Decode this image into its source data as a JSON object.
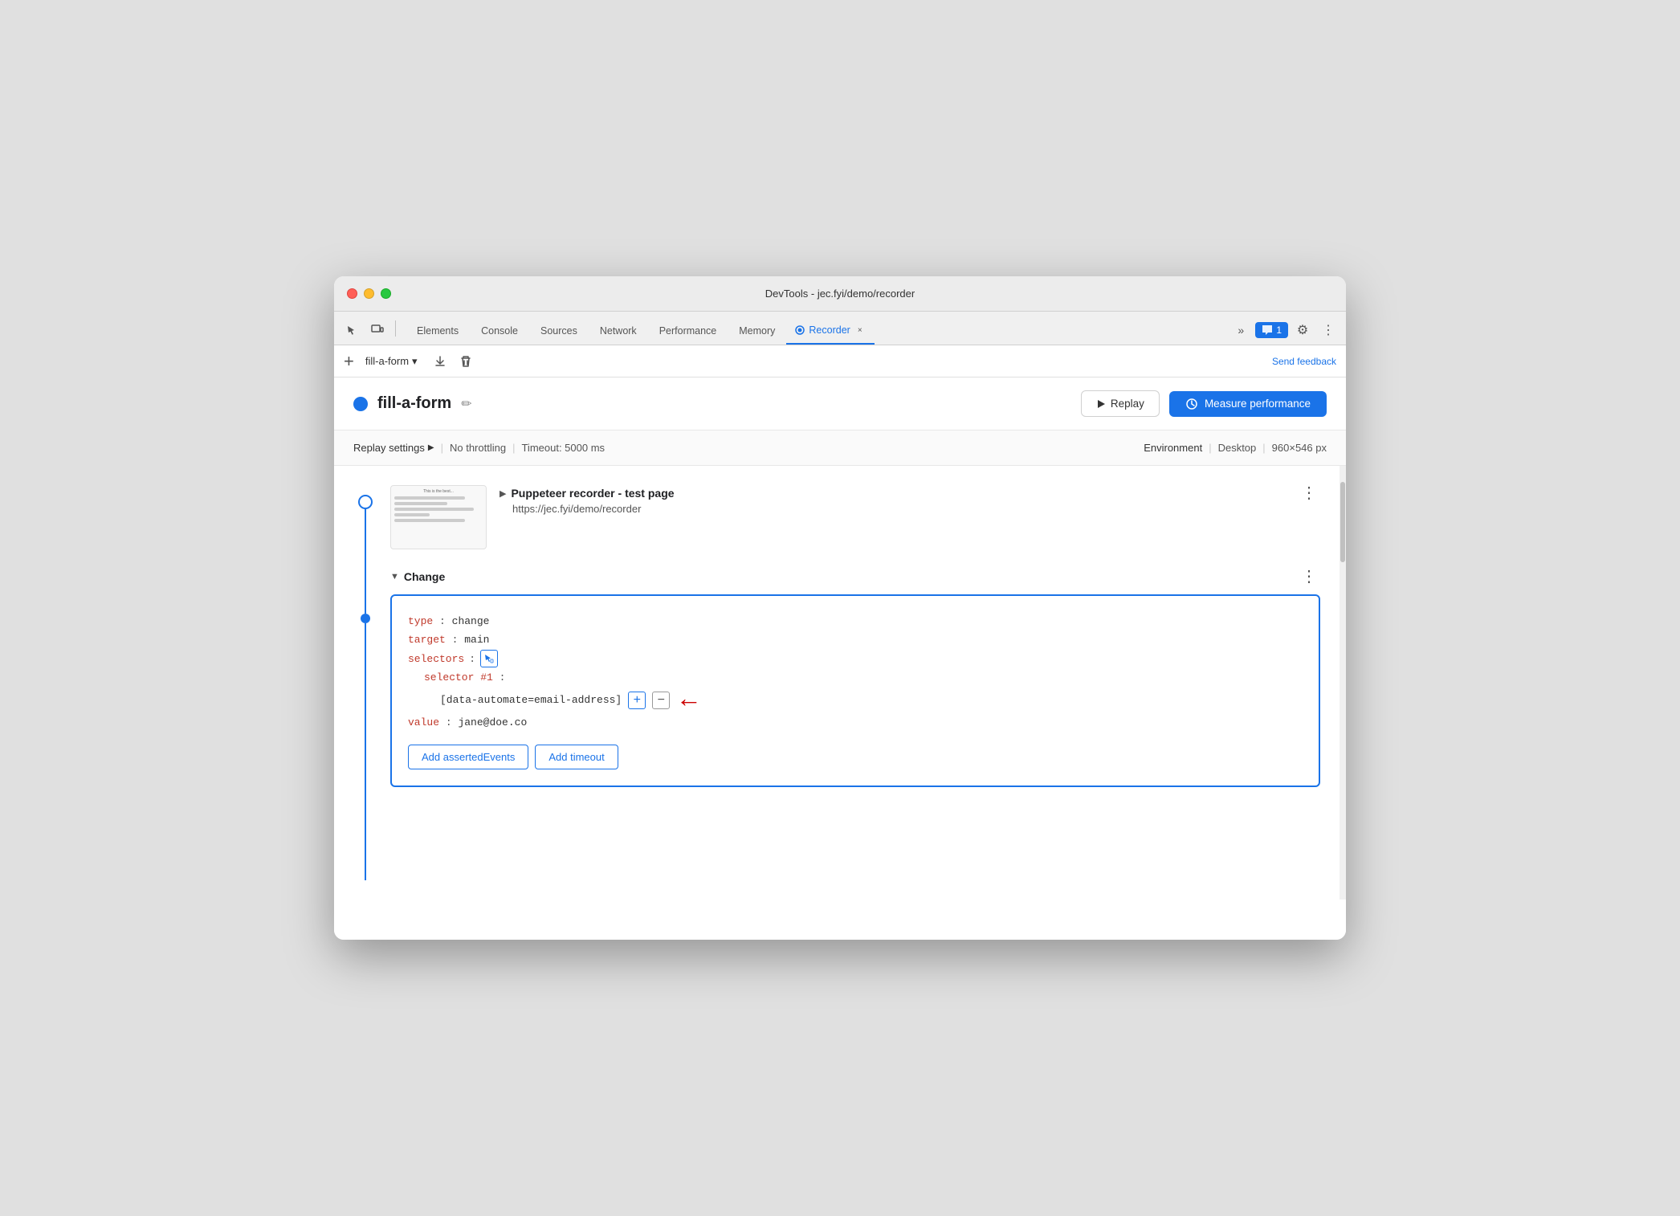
{
  "window": {
    "title": "DevTools - jec.fyi/demo/recorder"
  },
  "devtools_tabs": {
    "items": [
      {
        "label": "Elements",
        "active": false
      },
      {
        "label": "Console",
        "active": false
      },
      {
        "label": "Sources",
        "active": false
      },
      {
        "label": "Network",
        "active": false
      },
      {
        "label": "Performance",
        "active": false
      },
      {
        "label": "Memory",
        "active": false
      },
      {
        "label": "Recorder",
        "active": true
      }
    ],
    "recorder_close": "×",
    "more_tabs": "»",
    "chat_badge": "1",
    "settings_icon": "⚙",
    "more_icon": "⋮"
  },
  "toolbar": {
    "add_label": "+",
    "recording_name": "fill-a-form",
    "dropdown_icon": "▾",
    "export_icon": "⤓",
    "delete_icon": "🗑",
    "send_feedback": "Send feedback"
  },
  "recording_header": {
    "dot_color": "#1a73e8",
    "title": "fill-a-form",
    "edit_icon": "✏",
    "replay_label": "Replay",
    "measure_label": "Measure performance"
  },
  "replay_settings": {
    "settings_label": "Replay settings",
    "arrow": "▶",
    "throttling": "No throttling",
    "timeout": "Timeout: 5000 ms",
    "env_label": "Environment",
    "env_type": "Desktop",
    "env_size": "960×546 px"
  },
  "steps": {
    "step1": {
      "title": "Puppeteer recorder - test page",
      "url": "https://jec.fyi/demo/recorder",
      "expanded": false
    },
    "step2": {
      "title": "Change",
      "expanded": true,
      "code": {
        "type_key": "type",
        "type_value": "change",
        "target_key": "target",
        "target_value": "main",
        "selectors_key": "selectors",
        "selector_num_key": "selector #1",
        "selector_value": "[data-automate=email-address]",
        "value_key": "value",
        "value_val": "jane@doe.co"
      },
      "btn_assert": "Add assertedEvents",
      "btn_timeout": "Add timeout"
    }
  }
}
